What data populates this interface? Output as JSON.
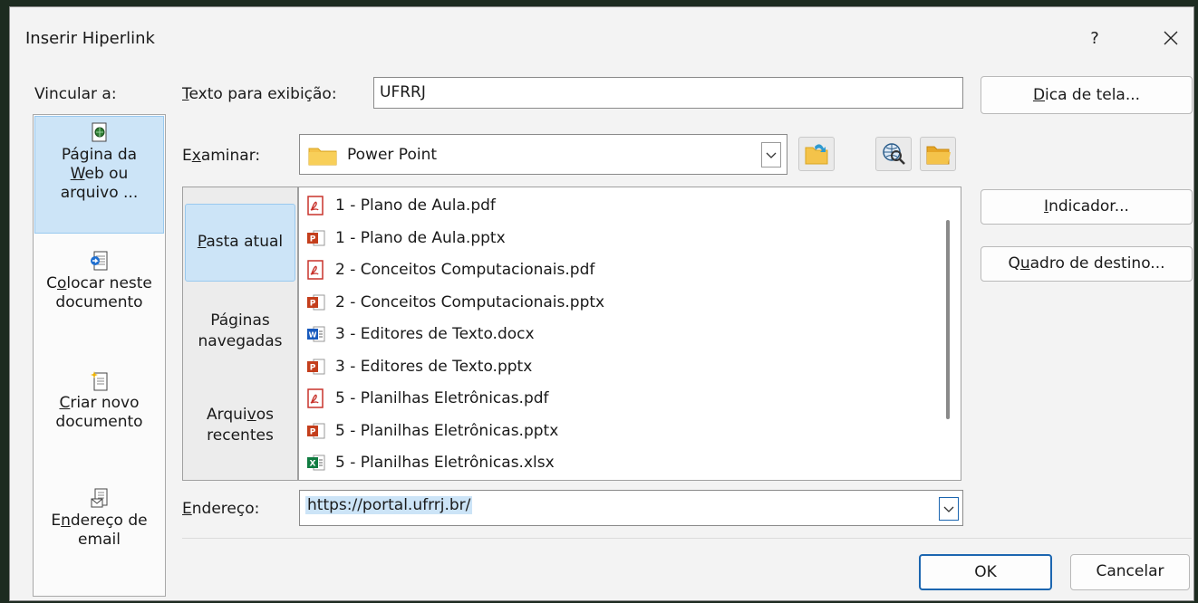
{
  "window": {
    "title": "Inserir Hiperlink",
    "help": "?",
    "close": "✕"
  },
  "link_to": {
    "label": "Vincular a:",
    "items": [
      {
        "line1": "Página da",
        "line2a": "",
        "line2u": "W",
        "line2b": "eb ou",
        "line3": "arquivo ...",
        "icon": "web-page-icon",
        "selected": true
      },
      {
        "line1a": "C",
        "line1u": "o",
        "line1b": "locar neste",
        "line2": "documento",
        "icon": "place-in-document-icon"
      },
      {
        "line1u": "C",
        "line1b": "riar novo",
        "line2": "documento",
        "icon": "new-document-icon"
      },
      {
        "line1a": "E",
        "line1u": "n",
        "line1b": "dereço de",
        "line2": "email",
        "icon": "email-address-icon"
      }
    ]
  },
  "text_to_display": {
    "label_u": "T",
    "label_rest": "exto para exibição:",
    "value": "UFRRJ"
  },
  "screentip_button": {
    "u": "D",
    "rest": "ica de tela..."
  },
  "look_in": {
    "label_a": "E",
    "label_u": "x",
    "label_rest": "aminar:",
    "value": "Power Point",
    "icon": "folder-icon"
  },
  "tools": [
    "up-folder-icon",
    "browse-web-icon",
    "browse-file-icon"
  ],
  "look_tabs": [
    {
      "u": "P",
      "rest": "asta atual",
      "selected": true
    },
    {
      "line1a": "Pá",
      "line1u": "g",
      "line1b": "inas",
      "line2": "navegadas"
    },
    {
      "line1a": "Arqui",
      "line1u": "v",
      "line1b": "os",
      "line2": "recentes"
    }
  ],
  "files": [
    {
      "name": "1 - Plano de Aula.pdf",
      "type": "pdf"
    },
    {
      "name": "1 - Plano de Aula.pptx",
      "type": "pptx"
    },
    {
      "name": "2 - Conceitos Computacionais.pdf",
      "type": "pdf"
    },
    {
      "name": "2 - Conceitos Computacionais.pptx",
      "type": "pptx"
    },
    {
      "name": "3 - Editores de Texto.docx",
      "type": "docx"
    },
    {
      "name": "3 - Editores de Texto.pptx",
      "type": "pptx"
    },
    {
      "name": "5 - Planilhas Eletrônicas.pdf",
      "type": "pdf"
    },
    {
      "name": "5 - Planilhas Eletrônicas.pptx",
      "type": "pptx"
    },
    {
      "name": "5 - Planilhas Eletrônicas.xlsx",
      "type": "xlsx"
    }
  ],
  "bookmark_button": {
    "u": "I",
    "rest": "ndicador..."
  },
  "target_frame_button": {
    "a": "Q",
    "u": "u",
    "rest": "adro de destino..."
  },
  "address": {
    "label_u": "E",
    "label_rest": "ndereço:",
    "value": "https://portal.ufrrj.br/"
  },
  "ok_button": "OK",
  "cancel_button": "Cancelar",
  "colors": {
    "selection": "#cce4f7",
    "accent": "#1c66b0",
    "pdf": "#c8332c",
    "pptx": "#c43e1c",
    "docx": "#185abd",
    "xlsx": "#107c41",
    "folder": "#f4c34a"
  }
}
